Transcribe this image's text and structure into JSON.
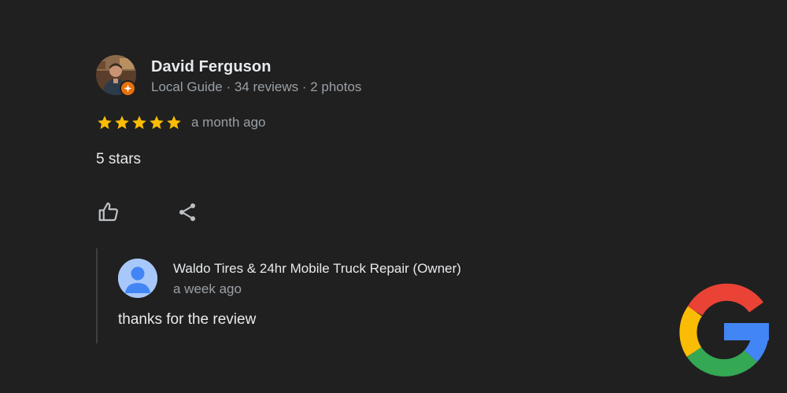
{
  "review": {
    "author": {
      "name": "David Ferguson",
      "meta": "Local Guide · 34 reviews · 2 photos",
      "badge": "local-guide-badge"
    },
    "rating": {
      "stars": 5,
      "max_stars": 5,
      "star_color": "#fbbc04"
    },
    "time_ago": "a month ago",
    "text": "5 stars",
    "actions": {
      "like_icon": "thumbs-up-icon",
      "share_icon": "share-icon"
    }
  },
  "owner_reply": {
    "name": "Waldo Tires & 24hr Mobile Truck Repair (Owner)",
    "time_ago": "a week ago",
    "text": "thanks for the review"
  },
  "brand": {
    "logo": "google-g-logo",
    "colors": {
      "red": "#ea4335",
      "yellow": "#fbbc05",
      "green": "#34a853",
      "blue": "#4285f4"
    }
  },
  "theme": {
    "background": "#202020",
    "primary_text": "#e8eaed",
    "secondary_text": "#9aa0a6"
  }
}
